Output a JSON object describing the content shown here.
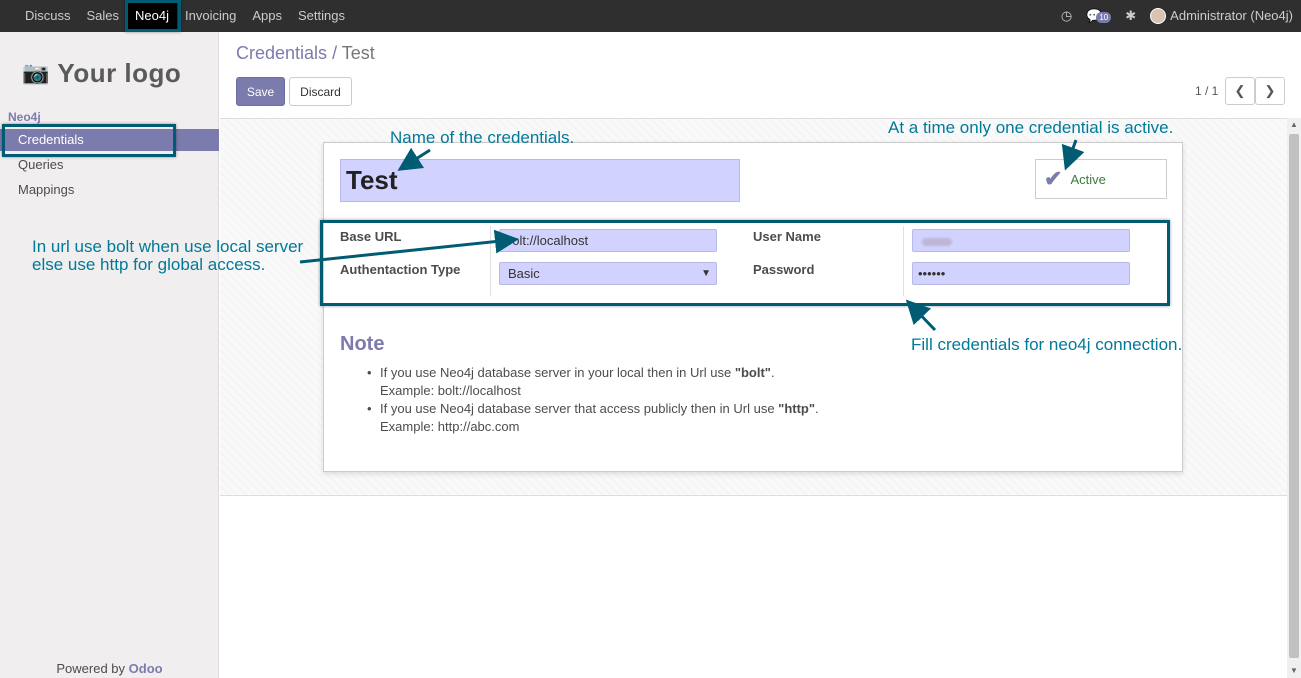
{
  "topbar": {
    "menu": [
      "Discuss",
      "Sales",
      "Neo4j",
      "Invoicing",
      "Apps",
      "Settings"
    ],
    "active_menu": "Neo4j",
    "message_count": "10",
    "user": "Administrator (Neo4j)"
  },
  "sidebar": {
    "logo_text": "Your logo",
    "section": "Neo4j",
    "items": [
      "Credentials",
      "Queries",
      "Mappings"
    ],
    "powered_prefix": "Powered by",
    "powered_brand": "Odoo"
  },
  "header": {
    "breadcrumb_parent": "Credentials",
    "breadcrumb_sep": "/",
    "breadcrumb_current": "Test",
    "save_label": "Save",
    "discard_label": "Discard",
    "pager": "1 / 1"
  },
  "form": {
    "name": "Test",
    "active_label": "Active",
    "base_url_label": "Base URL",
    "base_url_value": "bolt://localhost",
    "auth_type_label": "Authentaction Type",
    "auth_type_value": "Basic",
    "username_label": "User Name",
    "password_label": "Password",
    "password_value": "••••••"
  },
  "note": {
    "title": "Note",
    "items": [
      {
        "line1_prefix": "If you use Neo4j database server in your local then in Url use ",
        "line1_bold": "\"bolt\"",
        "line1_suffix": ".",
        "line2": "Example: bolt://localhost"
      },
      {
        "line1_prefix": "If you use Neo4j database server that access publicly then in Url use ",
        "line1_bold": "\"http\"",
        "line1_suffix": ".",
        "line2": "Example: http://abc.com"
      }
    ]
  },
  "annotations": {
    "name": "Name of the credentials.",
    "active": "At a time only one credential is active.",
    "url_line1": "In url use bolt when use local server",
    "url_line2": "else use http for global access.",
    "fill": "Fill credentials for neo4j connection."
  },
  "colors": {
    "brand": "#7c7bad",
    "annotation": "#007a99",
    "highlight": "#005b73",
    "field_bg": "#d2d2ff"
  }
}
